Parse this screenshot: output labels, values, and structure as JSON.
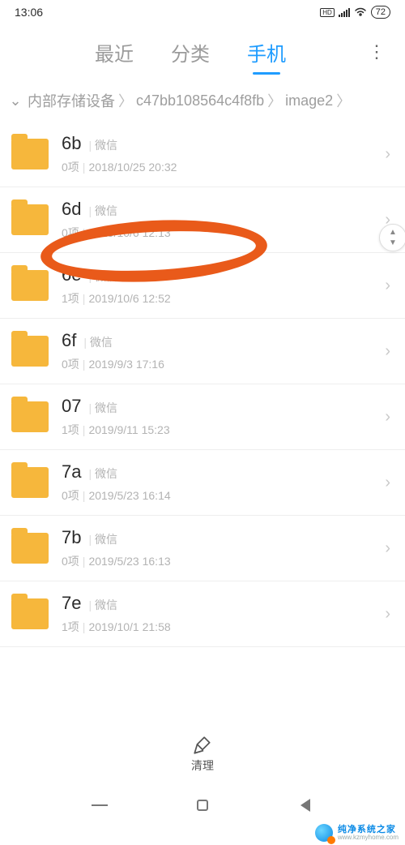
{
  "status": {
    "time": "13:06",
    "hd": "HD",
    "battery": "72"
  },
  "tabs": {
    "items": [
      "最近",
      "分类",
      "手机"
    ],
    "activeIndex": 2
  },
  "breadcrumb": {
    "segs": [
      "内部存储设备",
      "c47bb108564c4f8fb",
      "image2"
    ]
  },
  "rows": [
    {
      "name": "6b",
      "src": "微信",
      "count": "0项",
      "date": "2018/10/25 20:32"
    },
    {
      "name": "6d",
      "src": "微信",
      "count": "0项",
      "date": "2019/10/6 12:13"
    },
    {
      "name": "6e",
      "src": "微信",
      "count": "1项",
      "date": "2019/10/6 12:52"
    },
    {
      "name": "6f",
      "src": "微信",
      "count": "0项",
      "date": "2019/9/3 17:16"
    },
    {
      "name": "07",
      "src": "微信",
      "count": "1项",
      "date": "2019/9/11 15:23"
    },
    {
      "name": "7a",
      "src": "微信",
      "count": "0项",
      "date": "2019/5/23 16:14"
    },
    {
      "name": "7b",
      "src": "微信",
      "count": "0项",
      "date": "2019/5/23 16:13"
    },
    {
      "name": "7e",
      "src": "微信",
      "count": "1项",
      "date": "2019/10/1 21:58"
    }
  ],
  "cleanLabel": "清理",
  "watermark": {
    "cn": "纯净系统之家",
    "en": "www.kzmyhome.com"
  }
}
